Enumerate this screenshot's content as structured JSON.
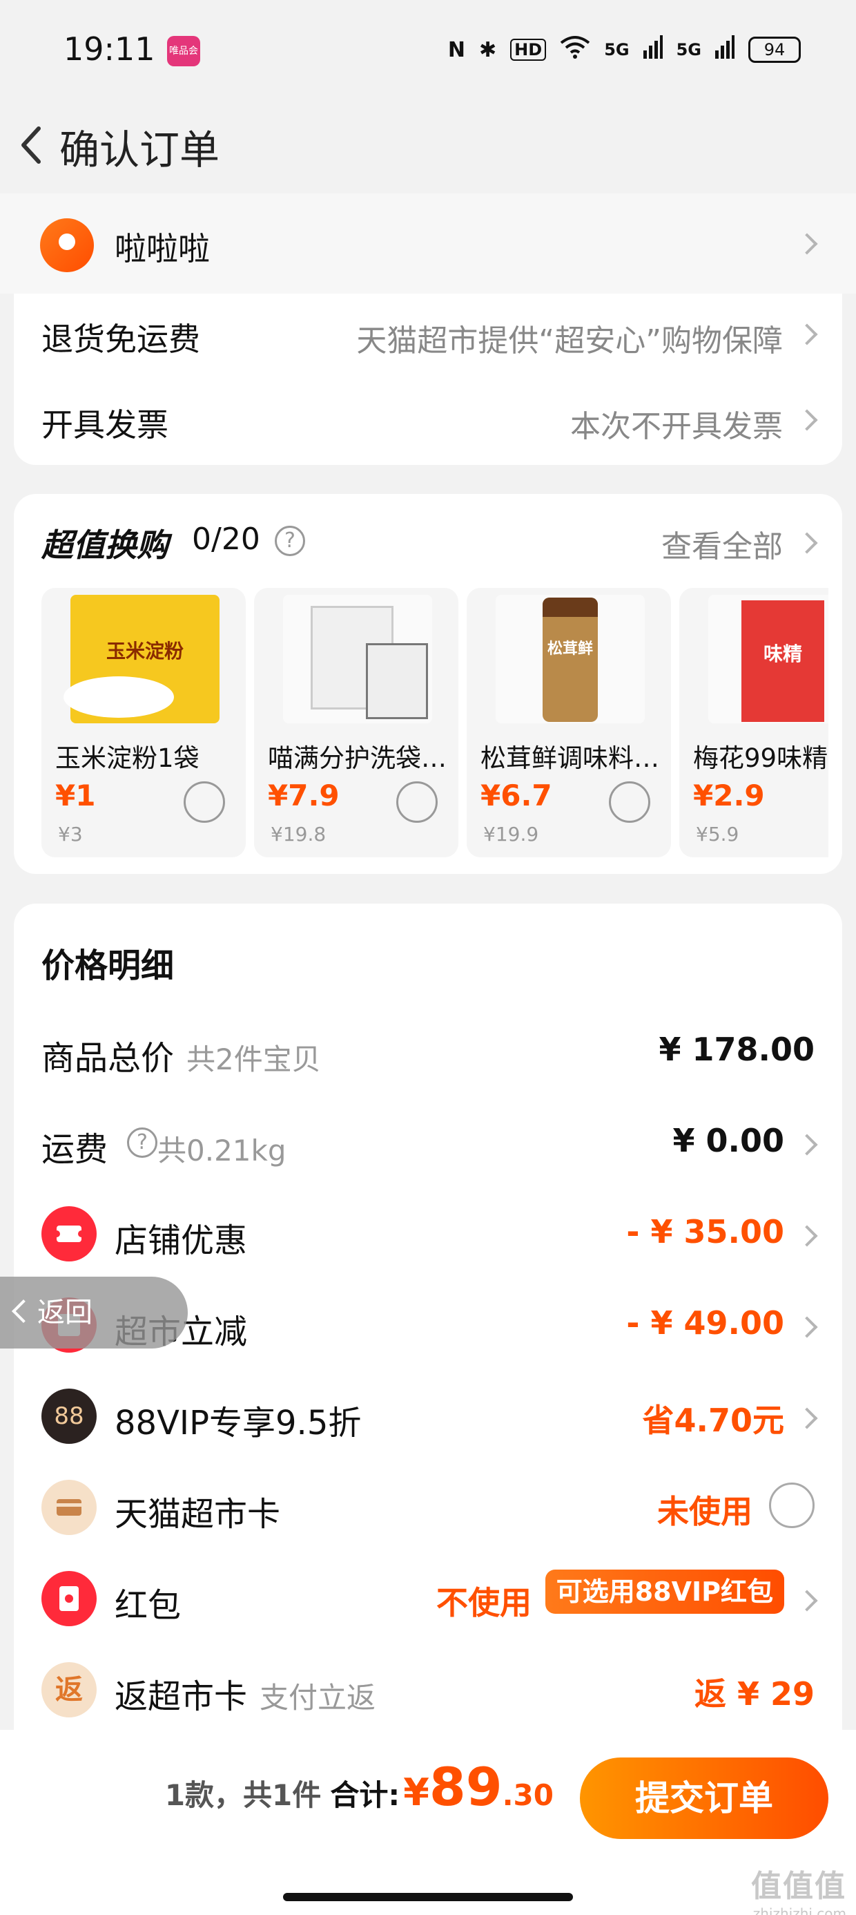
{
  "status": {
    "time": "19:11",
    "battery": "94",
    "icons": [
      "N",
      "✱",
      "HD",
      "wifi",
      "5G",
      "5G"
    ],
    "app_badge": "唯品会"
  },
  "nav": {
    "title": "确认订单"
  },
  "address": {
    "name": "啦啦啦"
  },
  "services": [
    {
      "label": "退货免运费",
      "value": "天猫超市提供“超安心”购物保障"
    },
    {
      "label": "开具发票",
      "value": "本次不开具发票"
    }
  ],
  "exchange": {
    "title": "超值换购",
    "count": "0/20",
    "help": "?",
    "view_all": "查看全部",
    "products": [
      {
        "name": "玉米淀粉1袋",
        "price": "¥1",
        "original": "¥3",
        "image_text": "玉米淀粉"
      },
      {
        "name": "喵满分护洗袋…",
        "price": "¥7.9",
        "original": "¥19.8",
        "image_text": ""
      },
      {
        "name": "松茸鲜调味料…",
        "price": "¥6.7",
        "original": "¥19.9",
        "image_text": "松茸鲜"
      },
      {
        "name": "梅花99味精",
        "price": "¥2.9",
        "original": "¥5.9",
        "image_text": "味精"
      }
    ]
  },
  "price_details": {
    "title": "价格明细",
    "rows": {
      "total": {
        "label": "商品总价",
        "sub": "共2件宝贝",
        "value": "¥ 178.00"
      },
      "shipping": {
        "label": "运费",
        "sub": "共0.21kg",
        "value": "¥ 0.00",
        "help": "?"
      },
      "shop_discount": {
        "label": "店铺优惠",
        "value": "- ¥ 35.00"
      },
      "market_cut": {
        "label": "超市立减",
        "value": "- ¥ 49.00"
      },
      "vip": {
        "label": "88VIP专享9.5折",
        "value": "省4.70元",
        "icon": "88"
      },
      "card": {
        "label": "天猫超市卡",
        "value": "未使用"
      },
      "redpacket": {
        "label": "红包",
        "value": "不使用",
        "tag": "可选用88VIP红包"
      },
      "cashback": {
        "label": "返超市卡",
        "sub": "支付立返",
        "value": "返 ¥ 29",
        "icon": "返"
      }
    }
  },
  "float_back": {
    "label": "返回"
  },
  "footer": {
    "count": "1款，共1件",
    "total_label": "合计:",
    "yen": "¥",
    "amount_int": "89",
    "amount_dec": ".30",
    "submit": "提交订单",
    "watermark": "值值值",
    "watermark_url": "zhizhizhi.com"
  },
  "colors": {
    "accent": "#ff5000",
    "background": "#f2f2f2"
  }
}
